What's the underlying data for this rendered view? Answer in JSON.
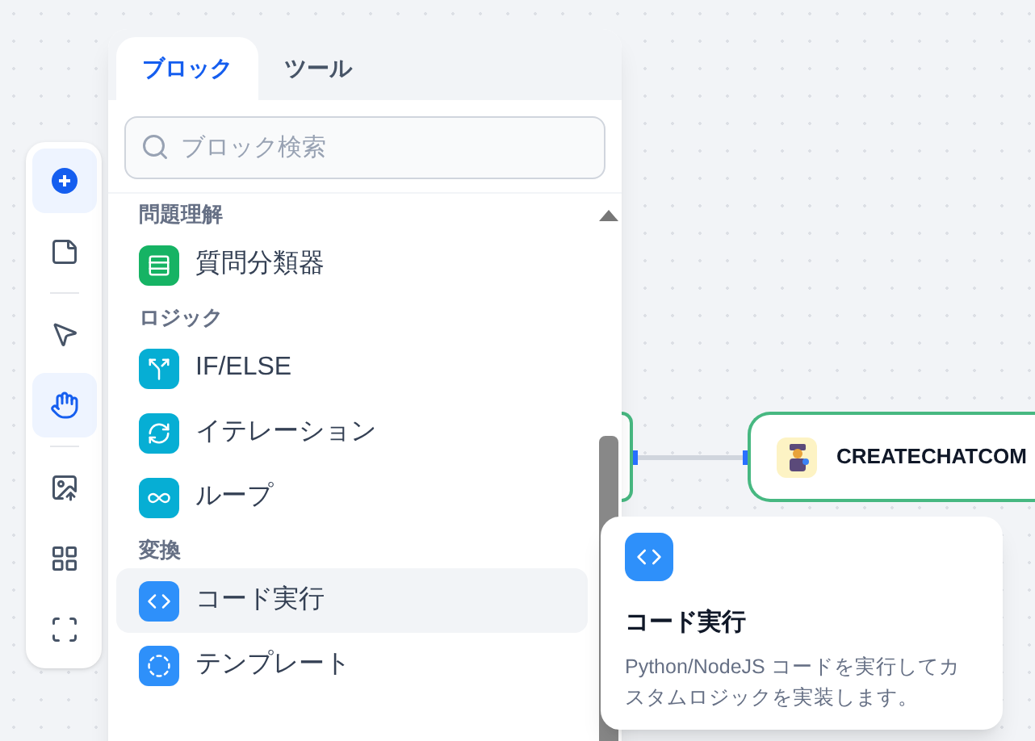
{
  "toolbar": [
    {
      "kind": "add",
      "selected": true
    },
    {
      "kind": "note",
      "selected": false
    },
    {
      "kind": "divider"
    },
    {
      "kind": "pointer",
      "selected": false
    },
    {
      "kind": "hand",
      "selected": true
    },
    {
      "kind": "divider"
    },
    {
      "kind": "export",
      "selected": false
    },
    {
      "kind": "organize",
      "selected": false
    },
    {
      "kind": "fit",
      "selected": false
    }
  ],
  "tabs": [
    {
      "label": "ブロック",
      "selected": true
    },
    {
      "label": "ツール",
      "selected": false
    }
  ],
  "search": {
    "placeholder": "ブロック検索"
  },
  "block_list": [
    {
      "kind": "header",
      "label": "問題理解"
    },
    {
      "kind": "classifier",
      "label": "質問分類器",
      "color": "#16b364",
      "selected": false
    },
    {
      "kind": "header",
      "label": "ロジック"
    },
    {
      "kind": "branch",
      "label": "IF/ELSE",
      "color": "#06aed4",
      "selected": false
    },
    {
      "kind": "cycle",
      "label": "イテレーション",
      "color": "#06aed4",
      "selected": false
    },
    {
      "kind": "infinity",
      "label": "ループ",
      "color": "#06aed4",
      "selected": false
    },
    {
      "kind": "header",
      "label": "変換"
    },
    {
      "kind": "code",
      "label": "コード実行",
      "color": "#2e90fa",
      "selected": true
    },
    {
      "kind": "template",
      "label": "テンプレート",
      "color": "#2e90fa",
      "selected": false
    }
  ],
  "tooltip": {
    "title": "コード実行",
    "description": "Python/NodeJS コードを実行してカスタムロジックを実装します。"
  },
  "canvas_node": {
    "title": "CREATECHATCOM"
  }
}
